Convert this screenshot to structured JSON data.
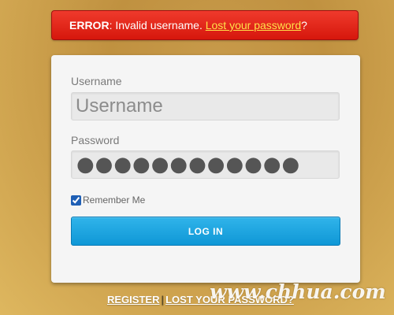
{
  "error": {
    "prefix": "ERROR",
    "message": ": Invalid username. ",
    "link": "Lost your password",
    "suffix": "?"
  },
  "form": {
    "username_label": "Username",
    "username_placeholder": "Username",
    "password_label": "Password",
    "password_value": "●●●●●●●●●●●●",
    "remember_label": "Remember Me",
    "remember_checked": true,
    "login_button": "LOG IN"
  },
  "footer": {
    "register": "REGISTER",
    "separator": "|",
    "lost_password": "LOST YOUR PASSWORD?"
  },
  "watermark": "www.chhua.com",
  "colors": {
    "error_bg": "#e02a1d",
    "error_link": "#ffe14a",
    "button_bg": "#1fa6e0",
    "panel_bg": "#f5f5f5"
  }
}
